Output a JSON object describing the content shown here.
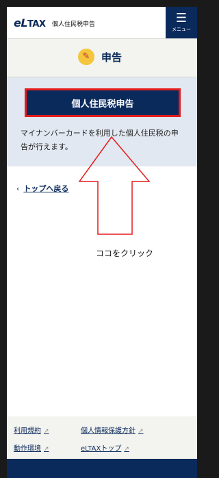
{
  "header": {
    "logo": "eL",
    "logo_suffix": "TAX",
    "title": "個人住民税申告",
    "menu_label": "メニュー"
  },
  "section": {
    "title": "申告",
    "icon": "pen-document-icon"
  },
  "card": {
    "button_label": "個人住民税申告",
    "description": "マイナンバーカードを利用した個人住民税の申告が行えます。"
  },
  "nav": {
    "back_label": "トップへ戻る"
  },
  "annotation": {
    "text": "ココをクリック",
    "highlight_color": "#e41c1c"
  },
  "footer": {
    "links": [
      "利用規約",
      "個人情報保護方針",
      "動作環境",
      "eLTAXトップ"
    ]
  },
  "colors": {
    "brand": "#0b2a5c",
    "card_bg": "#e2e8f1"
  }
}
